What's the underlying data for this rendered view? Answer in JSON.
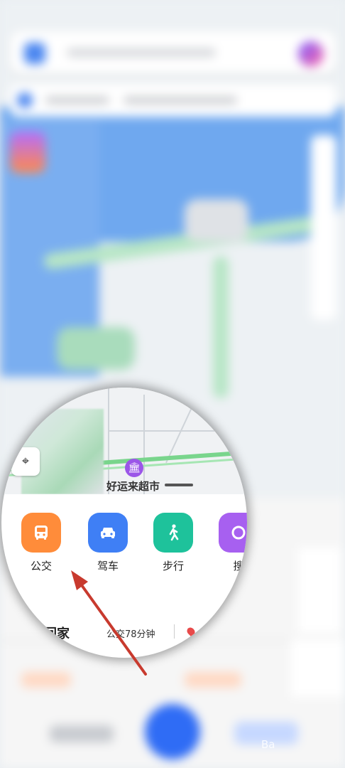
{
  "lens": {
    "poi_label": "好运来超市",
    "poi_icon": "shop-icon",
    "quick_actions": [
      {
        "label": "公交",
        "icon": "bus-icon",
        "color": "#ff8c3a"
      },
      {
        "label": "驾车",
        "icon": "car-icon",
        "color": "#3f7ff5"
      },
      {
        "label": "步行",
        "icon": "walk-icon",
        "color": "#1ec29b"
      },
      {
        "label": "搜",
        "icon": "search-icon",
        "color": "#a760f0"
      }
    ],
    "home": {
      "label": "回家",
      "eta": "公交78分钟"
    }
  },
  "watermark": "Ba"
}
